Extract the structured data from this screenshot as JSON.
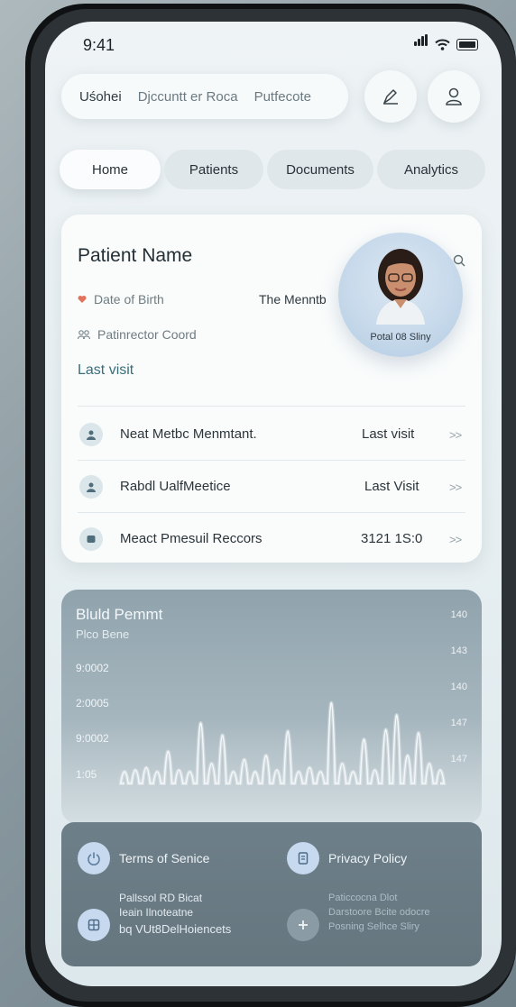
{
  "status": {
    "time": "9:41"
  },
  "search": {
    "items": [
      "Uśohei",
      "Djccuntt er Roca",
      "Putfecote"
    ]
  },
  "tabs": [
    "Home",
    "Patients",
    "Documents",
    "Analytics"
  ],
  "patient": {
    "name": "Patient Name",
    "dob_label": "Date of Birth",
    "month": "The Menntb",
    "coordinator": "Patinrector Coord",
    "last_visit": "Last visit",
    "avatar_label": "Potal 08 Sliny"
  },
  "rows": [
    {
      "title": "Neat Metbc Menmtant.",
      "right": "Last visit",
      "chev": ">>"
    },
    {
      "title": "Rabdl UalfMeetice",
      "right": "Last Visit",
      "chev": ">>"
    },
    {
      "title": "Meact Pmesuil Reccors",
      "right": "3121 1S:0",
      "chev": ">>"
    }
  ],
  "chart": {
    "title": "Bluld Pemmt",
    "subtitle": "Plco Bene",
    "y_labels": [
      "9:0002",
      "2:0005",
      "9:0002",
      "1:05"
    ],
    "right_labels": [
      "140",
      "143",
      "140",
      "147",
      "147"
    ],
    "chart_data": {
      "type": "line",
      "title": "Bluld Pemmt",
      "subtitle": "Plco Bene",
      "series": [
        {
          "values": [
            0.1,
            0.12,
            0.15,
            0.1,
            0.35,
            0.12,
            0.1,
            0.7,
            0.2,
            0.55,
            0.1,
            0.25,
            0.1,
            0.3,
            0.12,
            0.6,
            0.1,
            0.15,
            0.1,
            0.95,
            0.2,
            0.1,
            0.5,
            0.12,
            0.62,
            0.8,
            0.3,
            0.58,
            0.2,
            0.12
          ]
        }
      ]
    }
  },
  "footer": {
    "terms": "Terms of Senice",
    "privacy": "Privacy Policy",
    "block_left": [
      "Pallssol RD Bicat",
      "Ieain Ilnoteatne",
      "bq VUt8DelHoiencets"
    ],
    "block_right": [
      "Paticcocna Dlot",
      "Darstoore Bcite odocre",
      "Posning Selhce Sliry"
    ]
  }
}
